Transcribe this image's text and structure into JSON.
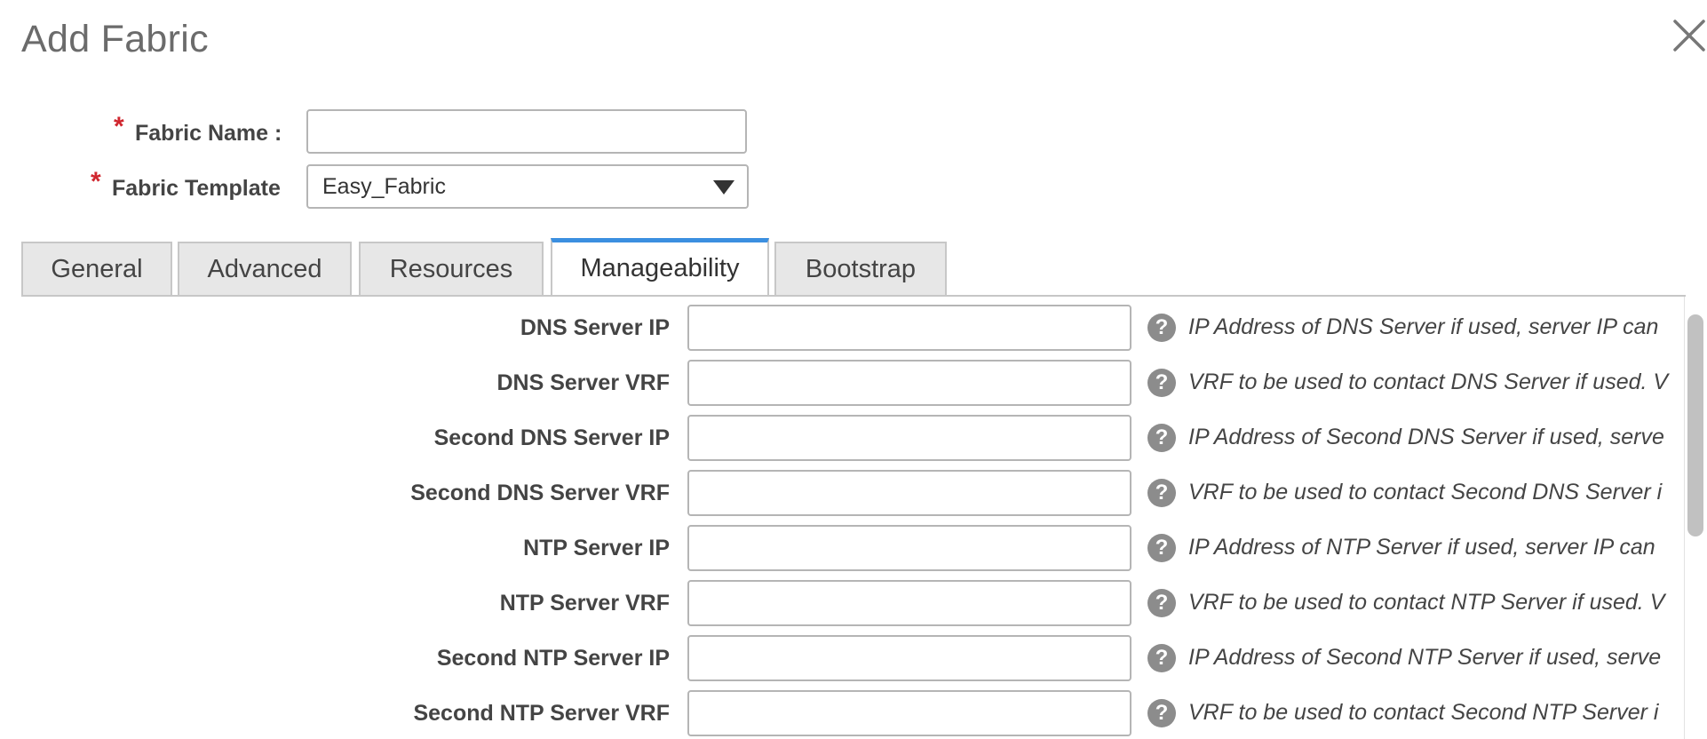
{
  "dialog": {
    "title": "Add Fabric",
    "close_icon": "close-icon"
  },
  "fabric_name": {
    "label": "Fabric Name :",
    "value": "",
    "placeholder": ""
  },
  "fabric_template": {
    "label": "Fabric Template",
    "value": "Easy_Fabric"
  },
  "required_mark": "*",
  "tabs": [
    {
      "label": "General",
      "active": false
    },
    {
      "label": "Advanced",
      "active": false
    },
    {
      "label": "Resources",
      "active": false
    },
    {
      "label": "Manageability",
      "active": true
    },
    {
      "label": "Bootstrap",
      "active": false
    }
  ],
  "fields": [
    {
      "label": "DNS Server IP",
      "value": "",
      "help": "IP Address of DNS Server if used, server IP can"
    },
    {
      "label": "DNS Server VRF",
      "value": "",
      "help": "VRF to be used to contact DNS Server if used. V"
    },
    {
      "label": "Second DNS Server IP",
      "value": "",
      "help": "IP Address of Second DNS Server if used, serve"
    },
    {
      "label": "Second DNS Server VRF",
      "value": "",
      "help": "VRF to be used to contact Second DNS Server i"
    },
    {
      "label": "NTP Server IP",
      "value": "",
      "help": "IP Address of NTP Server if used, server IP can"
    },
    {
      "label": "NTP Server VRF",
      "value": "",
      "help": "VRF to be used to contact NTP Server if used. V"
    },
    {
      "label": "Second NTP Server IP",
      "value": "",
      "help": "IP Address of Second NTP Server if used, serve"
    },
    {
      "label": "Second NTP Server VRF",
      "value": "",
      "help": "VRF to be used to contact Second NTP Server i"
    }
  ],
  "help_icon_glyph": "?",
  "colors": {
    "accent": "#3b8fe0",
    "required": "#d0262e",
    "help_icon": "#8c8c8c"
  }
}
